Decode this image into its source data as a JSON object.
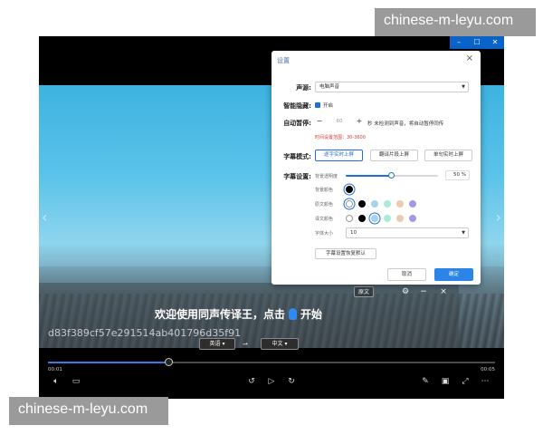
{
  "watermark": {
    "text": "chinese-m-leyu.com"
  },
  "window": {
    "minimize": "–",
    "maximize": "☐",
    "close": "✕"
  },
  "settings": {
    "title": "设置",
    "audio_source": {
      "label": "声源:",
      "value": "电脑声音"
    },
    "smart_hide": {
      "label": "智能隐藏:",
      "option": "开启",
      "checked": true
    },
    "auto_pause": {
      "label": "自动暂停:",
      "value": "60",
      "suffix": "秒 未检测到声音，将自动暂停同传",
      "hint": "时间设置范围：30-3600"
    },
    "subtitle_mode": {
      "label": "字幕模式:",
      "options": [
        "逐字实时上屏",
        "翻译片段上屏",
        "单句实时上屏"
      ],
      "selected_index": 0
    },
    "subtitle_settings": {
      "label": "字幕设置:",
      "bg_opacity_label": "背景透明度",
      "bg_opacity_value": "50 %",
      "bg_opacity": 0.5,
      "bg_color_label": "背景颜色",
      "source_color_label": "原文颜色",
      "target_color_label": "译文颜色",
      "font_size_label": "字体大小",
      "font_size_value": "10",
      "reset_label": "字幕设置恢复默认",
      "bg_colors": [
        "#000000"
      ],
      "palette": [
        "#ffffff",
        "#000000",
        "#a8d0ef",
        "#a8ecd8",
        "#ecccb0",
        "#a29ae8"
      ]
    },
    "cancel": "取消",
    "confirm": "确定"
  },
  "subtitle_bar": {
    "orig_label": "原文",
    "line1_before": "欢迎使用同声传译王，点击",
    "line1_after": "开始",
    "line2": "d83f389cf57e291514ab401796d35f91",
    "source_lang": "英语",
    "target_lang": "中文"
  },
  "playback": {
    "current_time": "00:01",
    "total_time": "00:05",
    "progress": 0.27
  },
  "colors": {
    "accent": "#1e6fd9",
    "primary_button": "#2b84e8",
    "mic": "#2c8af0",
    "hint_red": "#d63a3a"
  },
  "icons": [
    "volume-icon",
    "subtitle-icon",
    "rewind-icon",
    "play-icon",
    "forward-icon",
    "edit-icon",
    "pip-icon",
    "fullscreen-icon",
    "more-icon",
    "settings-gear-icon",
    "minimize-icon",
    "close-icon"
  ]
}
